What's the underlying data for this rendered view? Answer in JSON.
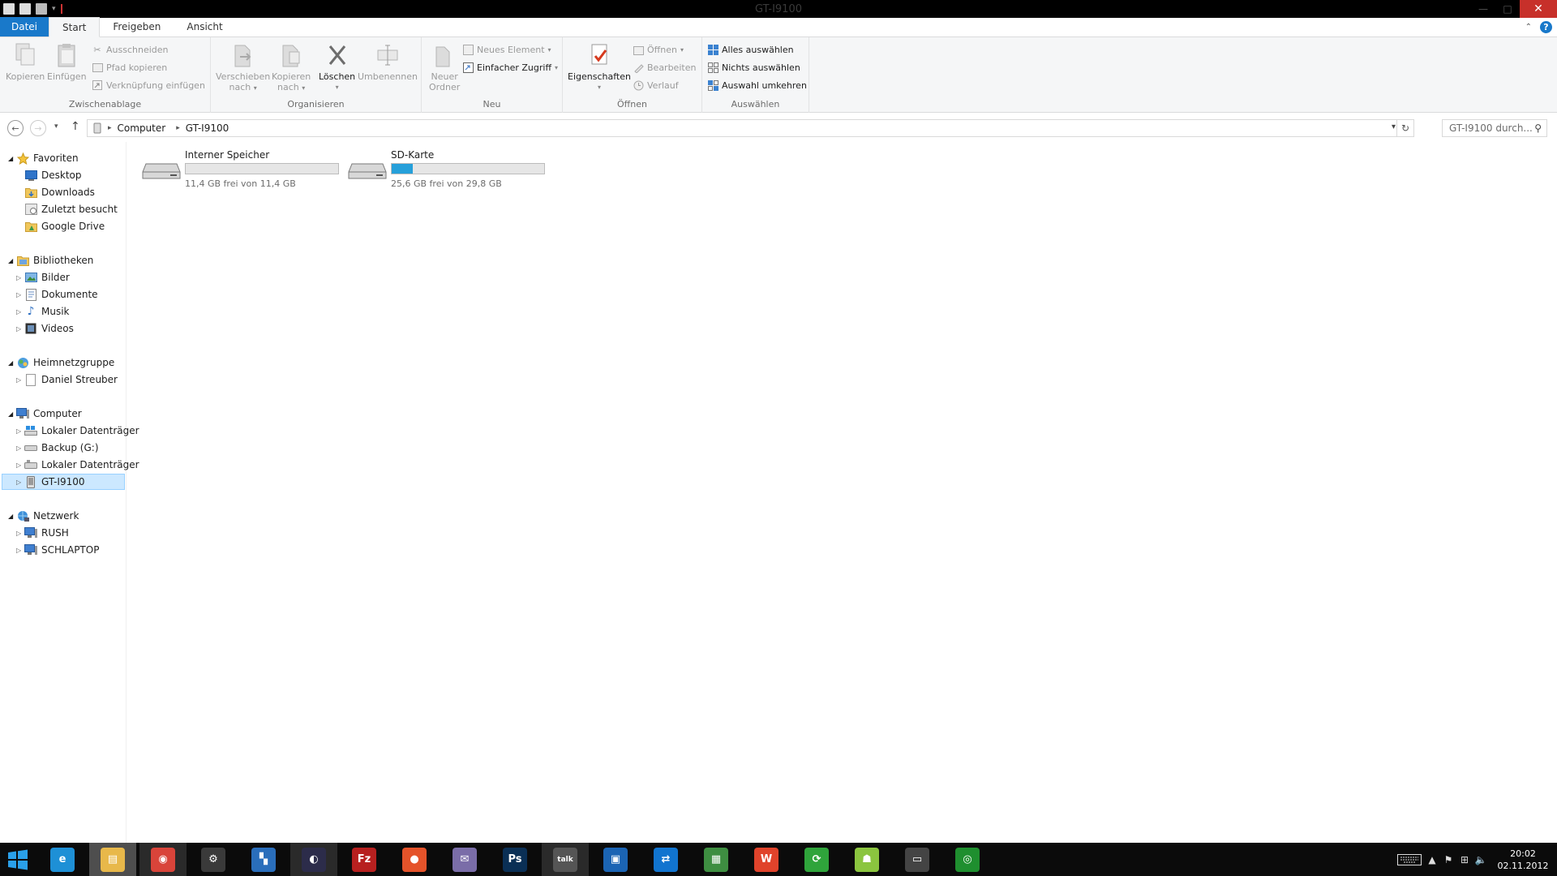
{
  "window": {
    "title": "GT-I9100",
    "minimize": "—",
    "maximize": "□",
    "close": "✕"
  },
  "ribbon_tabs": [
    {
      "label": "Datei"
    },
    {
      "label": "Start"
    },
    {
      "label": "Freigeben"
    },
    {
      "label": "Ansicht"
    }
  ],
  "ribbon": {
    "clipboard": {
      "label": "Zwischenablage",
      "copy": "Kopieren",
      "paste": "Einfügen",
      "cut": "Ausschneiden",
      "copy_path": "Pfad kopieren",
      "paste_shortcut": "Verknüpfung einfügen"
    },
    "organize": {
      "label": "Organisieren",
      "move_to_1": "Verschieben",
      "move_to_2": "nach",
      "copy_to_1": "Kopieren",
      "copy_to_2": "nach",
      "delete": "Löschen",
      "rename": "Umbenennen"
    },
    "new": {
      "label": "Neu",
      "new_folder_1": "Neuer",
      "new_folder_2": "Ordner",
      "new_item": "Neues Element",
      "easy_access": "Einfacher Zugriff"
    },
    "open": {
      "label": "Öffnen",
      "properties": "Eigenschaften",
      "open": "Öffnen",
      "edit": "Bearbeiten",
      "history": "Verlauf"
    },
    "select": {
      "label": "Auswählen",
      "select_all": "Alles auswählen",
      "select_none": "Nichts auswählen",
      "invert": "Auswahl umkehren"
    }
  },
  "address": {
    "crumbs": [
      "Computer",
      "GT-I9100"
    ],
    "search_placeholder": "GT-I9100 durch..."
  },
  "nav": {
    "favorites": {
      "label": "Favoriten",
      "items": [
        "Desktop",
        "Downloads",
        "Zuletzt besucht",
        "Google Drive"
      ]
    },
    "libraries": {
      "label": "Bibliotheken",
      "items": [
        "Bilder",
        "Dokumente",
        "Musik",
        "Videos"
      ]
    },
    "homegroup": {
      "label": "Heimnetzgruppe",
      "items": [
        "Daniel Streuber"
      ]
    },
    "computer": {
      "label": "Computer",
      "items": [
        "Lokaler Datenträger",
        "Backup (G:)",
        "Lokaler Datenträger",
        "GT-I9100"
      ]
    },
    "network": {
      "label": "Netzwerk",
      "items": [
        "RUSH",
        "SCHLAPTOP"
      ]
    }
  },
  "drives": [
    {
      "name": "Interner Speicher",
      "free": "11,4 GB frei von 11,4 GB",
      "used_fraction": 0.0
    },
    {
      "name": "SD-Karte",
      "free": "25,6 GB frei von 29,8 GB",
      "used_fraction": 0.14
    }
  ],
  "taskbar": {
    "apps": [
      {
        "icon": "ie-icon",
        "color": "#1e90d6"
      },
      {
        "icon": "explorer-icon",
        "color": "#e8b84a"
      },
      {
        "icon": "chrome-icon",
        "color": "#d9443a"
      },
      {
        "icon": "steam-icon",
        "color": "#3a3a3a"
      },
      {
        "icon": "app-blocks-icon",
        "color": "#2a6ebb"
      },
      {
        "icon": "eclipse-icon",
        "color": "#2c2c4a"
      },
      {
        "icon": "filezilla-icon",
        "color": "#b7201f"
      },
      {
        "icon": "origin-icon",
        "color": "#e5532a"
      },
      {
        "icon": "pidgin-icon",
        "color": "#7a6da8"
      },
      {
        "icon": "photoshop-icon",
        "color": "#0a2f55"
      },
      {
        "icon": "talk-icon",
        "color": "#555555"
      },
      {
        "icon": "virtualbox-icon",
        "color": "#1b64b4"
      },
      {
        "icon": "teamviewer-icon",
        "color": "#1174cf"
      },
      {
        "icon": "spreadsheet-icon",
        "color": "#3e8e41"
      },
      {
        "icon": "w-icon",
        "color": "#e0432b"
      },
      {
        "icon": "sync-icon",
        "color": "#2fa43b"
      },
      {
        "icon": "android-icon",
        "color": "#8bc53f"
      },
      {
        "icon": "camera-icon",
        "color": "#444444"
      },
      {
        "icon": "eye-icon",
        "color": "#1f8f2f"
      }
    ],
    "time": "20:02",
    "date": "02.11.2012"
  }
}
